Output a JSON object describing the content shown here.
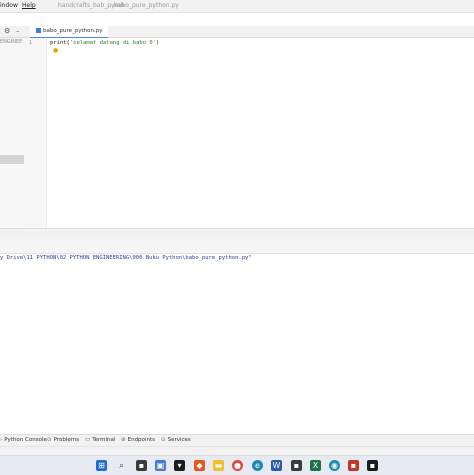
{
  "menubar": {
    "items": [
      "indow",
      "Help"
    ],
    "breadcrumb": [
      "handcrafts_bab_pymb",
      "babo_pure_python.py"
    ]
  },
  "editor": {
    "tab_label": "babo_pure_python.py",
    "project_label": "ENGINEE",
    "line_numbers": [
      "1"
    ],
    "code_fn": "print(",
    "code_str": "'selamat datang di babo 0'",
    "code_end": ")"
  },
  "console": {
    "path_line": "y Drive\\11 PYTHON\\02 PYTHON ENGINEERING\\000 Buku Python\\babo_pure_python.py\""
  },
  "toolwindows": [
    {
      "icon": "python-console-icon",
      "label": "Python Console"
    },
    {
      "icon": "problems-icon",
      "label": "Problems"
    },
    {
      "icon": "terminal-icon",
      "label": "Terminal"
    },
    {
      "icon": "endpoints-icon",
      "label": "Endpoints"
    },
    {
      "icon": "services-icon",
      "label": "Services"
    }
  ],
  "taskbar": {
    "icons": [
      "windows-start",
      "search",
      "task-view",
      "widgets",
      "ide-app",
      "brave-browser",
      "file-explorer",
      "chrome",
      "edge",
      "word",
      "excel",
      "app",
      "mail",
      "pycharm"
    ],
    "colors": {
      "windows": "#1f6fd1",
      "chrome": "#e2443b",
      "edge": "#1e88b4",
      "word": "#2b5aa8",
      "excel": "#1e7145",
      "brave": "#e8561f",
      "explorer": "#f2c02b",
      "pycharm": "#1c1c1c"
    }
  }
}
